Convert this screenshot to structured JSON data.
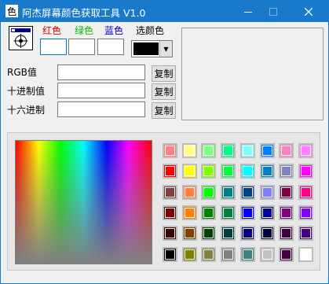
{
  "window": {
    "title": "阿杰屏幕颜色获取工具 V1.0",
    "titlebar_color": "#1979ca",
    "controls": {
      "minimize": "—",
      "maximize": "☐",
      "close": "✕"
    }
  },
  "color_labels": {
    "red": "红色",
    "green": "绿色",
    "blue": "蓝色",
    "select": "选颜色"
  },
  "label_colors": {
    "red": "#e00000",
    "green": "#00c000",
    "blue": "#0000e0"
  },
  "fields": {
    "red_value": "",
    "green_value": "",
    "blue_value": "",
    "selected_color": "#000000",
    "rgb_label": "RGB值",
    "rgb_value": "",
    "dec_label": "十进制值",
    "dec_value": "",
    "hex_label": "十六进制",
    "hex_value": ""
  },
  "buttons": {
    "copy_rgb": "复制",
    "copy_dec": "复制",
    "copy_hex": "复制"
  },
  "dropdown_arrow": "▼",
  "swatches": [
    [
      "#ff8080",
      "#ffff80",
      "#80ff80",
      "#00ff80",
      "#80ffff",
      "#0080ff",
      "#ff80c0",
      "#ff80ff"
    ],
    [
      "#ff0000",
      "#ffff00",
      "#80ff00",
      "#00ff40",
      "#00ffff",
      "#0080c0",
      "#8080c0",
      "#ff00ff"
    ],
    [
      "#804040",
      "#ff8040",
      "#00ff00",
      "#008080",
      "#004080",
      "#8080ff",
      "#800040",
      "#ff0080"
    ],
    [
      "#800000",
      "#ff8000",
      "#008000",
      "#008040",
      "#0000ff",
      "#0000a0",
      "#800080",
      "#8000ff"
    ],
    [
      "#400000",
      "#804000",
      "#004000",
      "#004040",
      "#000080",
      "#000040",
      "#400040",
      "#400080"
    ],
    [
      "#000000",
      "#808000",
      "#808040",
      "#808080",
      "#408080",
      "#c0c0c0",
      "#400040",
      "#ffffff"
    ]
  ]
}
